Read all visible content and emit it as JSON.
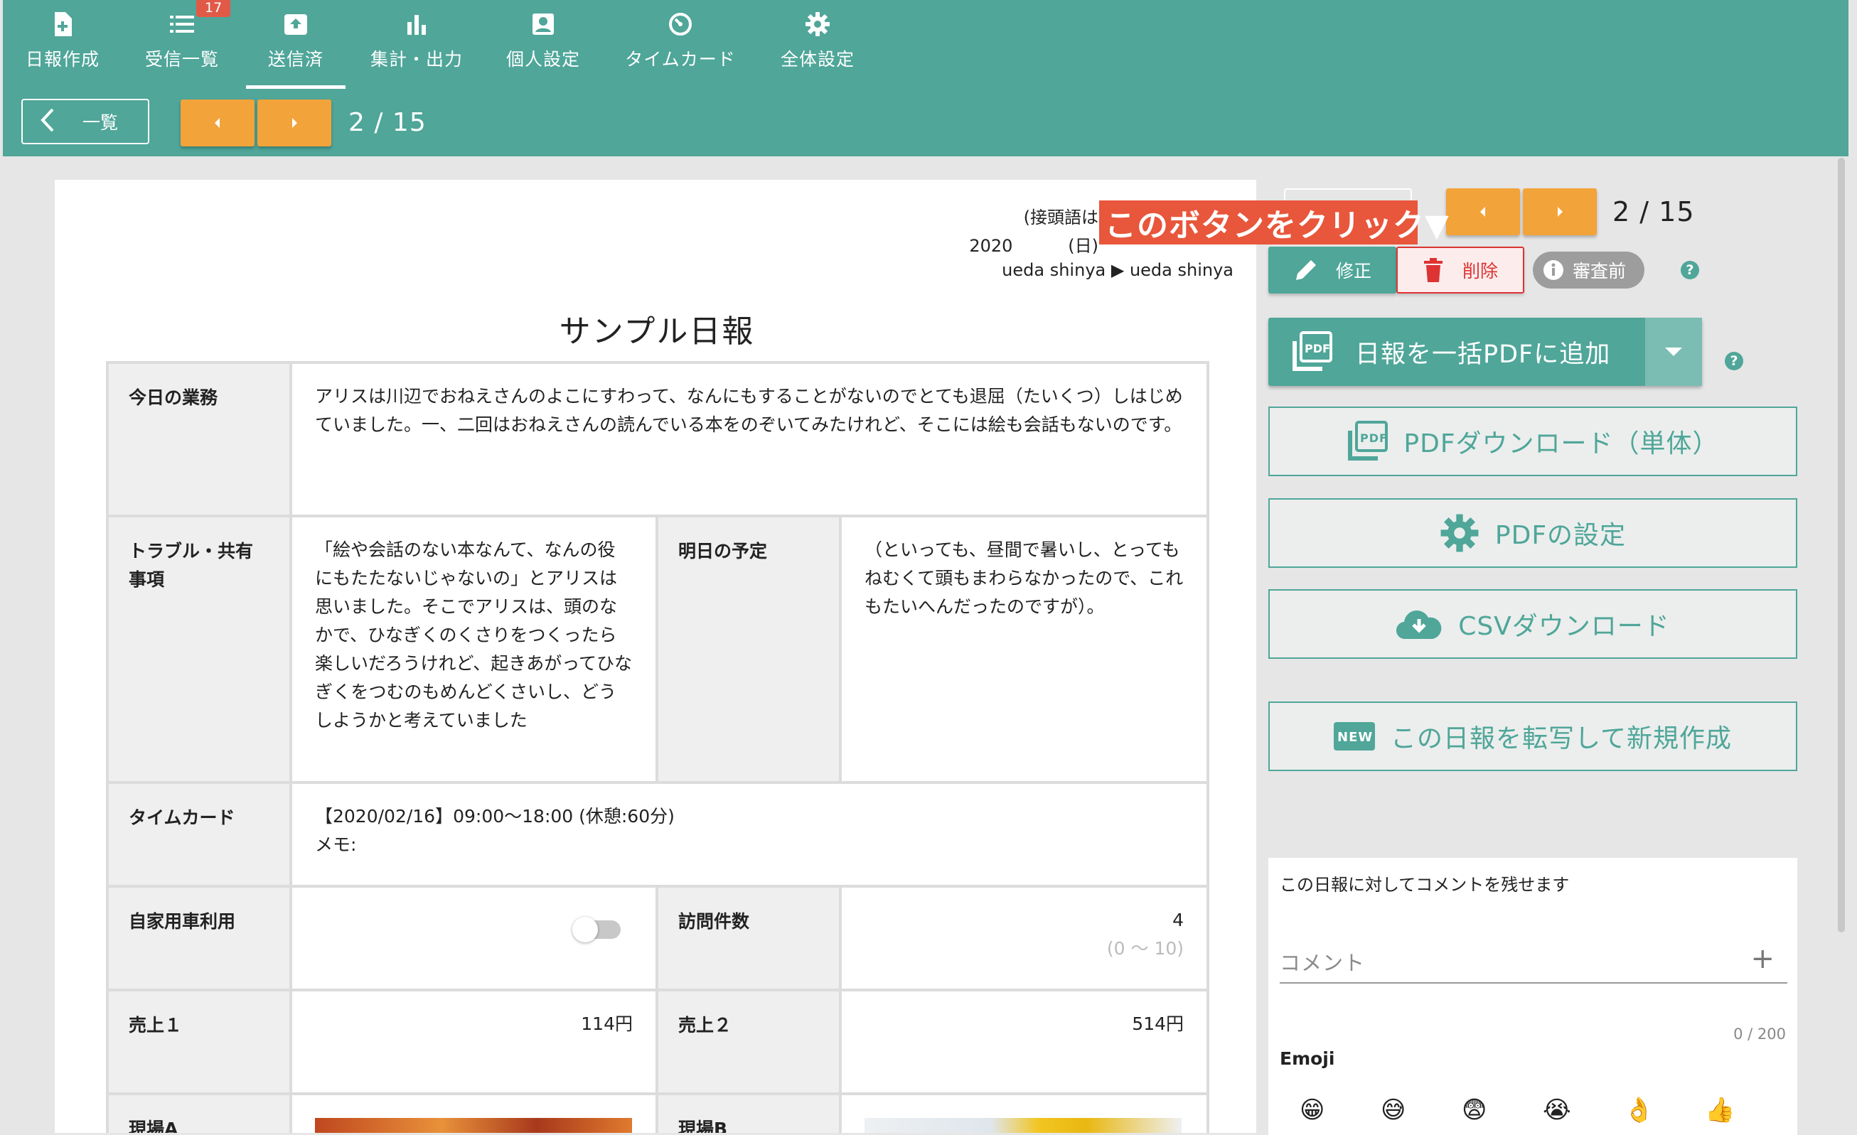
{
  "nav": {
    "items": [
      {
        "label": "日報作成",
        "icon": "file-plus-icon"
      },
      {
        "label": "受信一覧",
        "icon": "list-icon",
        "badge": "17"
      },
      {
        "label": "送信済",
        "icon": "outbox-icon",
        "active": true
      },
      {
        "label": "集計・出力",
        "icon": "bar-chart-icon"
      },
      {
        "label": "個人設定",
        "icon": "user-card-icon"
      },
      {
        "label": "タイムカード",
        "icon": "timer-icon"
      },
      {
        "label": "全体設定",
        "icon": "gear-icon"
      }
    ]
  },
  "toolbar": {
    "back_label": "一覧",
    "pager": "2 / 15"
  },
  "report": {
    "prefix_text": "(接頭語は",
    "date_text": "2020",
    "date_suffix": "(日)",
    "from_to": "ueda shinya ▶ ueda shinya",
    "title": "サンプル日報",
    "rows": {
      "today_label": "今日の業務",
      "today_value": "アリスは川辺でおねえさんのよこにすわって、なんにもすることがないのでとても退屈（たいくつ）しはじめていました。一、二回はおねえさんの読んでいる本をのぞいてみたけれど、そこには絵も会話もないのです。",
      "trouble_label": "トラブル・共有事項",
      "trouble_value": "「絵や会話のない本なんて、なんの役にもたたないじゃないの」とアリスは思いました。そこでアリスは、頭のなかで、ひなぎくのくさりをつくったら楽しいだろうけれど、起きあがってひなぎくをつむのもめんどくさいし、どうしようかと考えていました",
      "tomorrow_label": "明日の予定",
      "tomorrow_value": "（といっても、昼間で暑いし、とってもねむくて頭もまわらなかったので、これもたいへんだったのですが）。",
      "timecard_label": "タイムカード",
      "timecard_value": "【2020/02/16】09:00〜18:00 (休憩:60分)",
      "timecard_memo": "メモ:",
      "car_label": "自家用車利用",
      "car_value": false,
      "visits_label": "訪問件数",
      "visits_value": "4",
      "visits_range": "(0 〜 10)",
      "sales1_label": "売上１",
      "sales1_value": "114円",
      "sales2_label": "売上２",
      "sales2_value": "514円",
      "siteA_label": "現場A",
      "siteB_label": "現場B"
    }
  },
  "side": {
    "pager": "2 / 15",
    "edit_label": "修正",
    "delete_label": "削除",
    "status_label": "審査前",
    "bulk_pdf_label": "日報を一括PDFに追加",
    "pdf_single_label": "PDFダウンロード（単体）",
    "pdf_settings_label": "PDFの設定",
    "csv_label": "CSVダウンロード",
    "new_copy_label": "この日報を転写して新規作成",
    "new_badge": "NEW"
  },
  "comment": {
    "hint": "この日報に対してコメントを残せます",
    "placeholder": "コメント",
    "count": "0 / 200",
    "emoji_title": "Emoji",
    "emojis": [
      "😁",
      "😅",
      "😨",
      "😭",
      "👌",
      "👍"
    ]
  },
  "callout": {
    "text": "このボタンをクリック▼"
  },
  "colors": {
    "teal": "#4fa699",
    "orange": "#f2a33a",
    "danger": "#dd3333",
    "callout": "#e8563b"
  }
}
